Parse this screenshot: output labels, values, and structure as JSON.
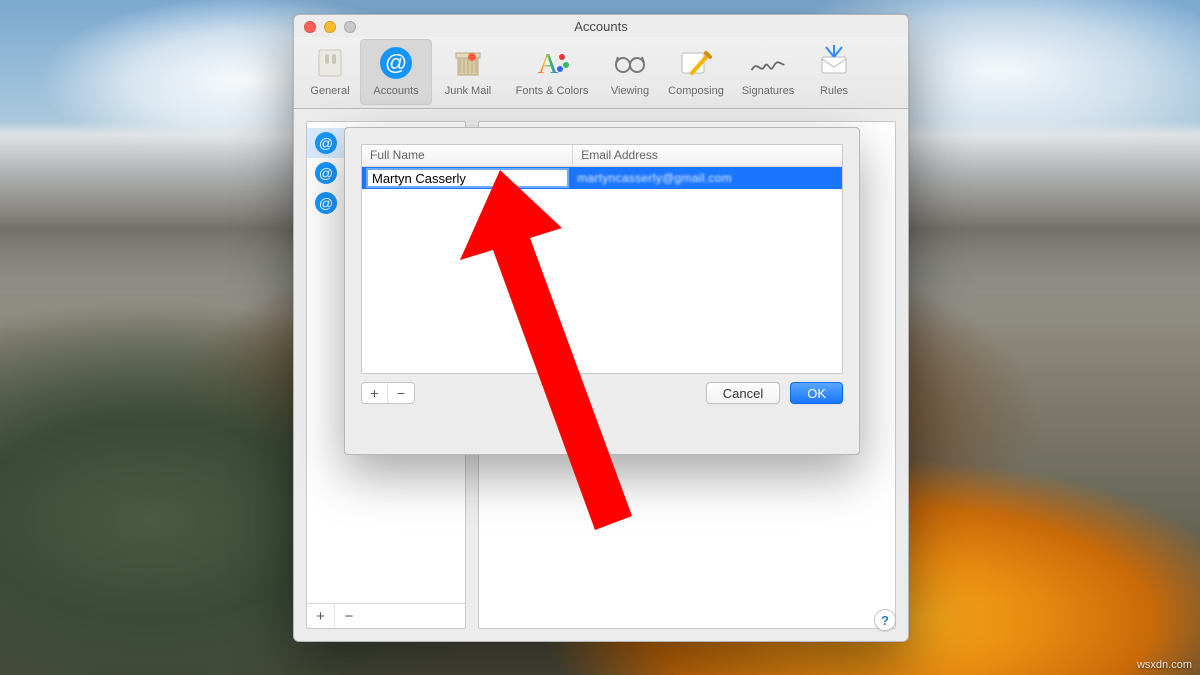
{
  "window": {
    "title": "Accounts"
  },
  "toolbar": {
    "items": [
      {
        "id": "general",
        "label": "General"
      },
      {
        "id": "accounts",
        "label": "Accounts"
      },
      {
        "id": "junk",
        "label": "Junk Mail"
      },
      {
        "id": "fonts",
        "label": "Fonts & Colors"
      },
      {
        "id": "viewing",
        "label": "Viewing"
      },
      {
        "id": "composing",
        "label": "Composing"
      },
      {
        "id": "signatures",
        "label": "Signatures"
      },
      {
        "id": "rules",
        "label": "Rules"
      }
    ],
    "active": "accounts"
  },
  "sidebar": {
    "add_label": "+",
    "remove_label": "−"
  },
  "sheet": {
    "headers": {
      "name": "Full Name",
      "email": "Email Address"
    },
    "row": {
      "full_name": "Martyn Casserly",
      "email_blurred": "martyncasserly@gmail.com"
    },
    "buttons": {
      "add": "+",
      "remove": "−",
      "cancel": "Cancel",
      "ok": "OK"
    }
  },
  "help": "?",
  "watermark": "wsxdn.com"
}
